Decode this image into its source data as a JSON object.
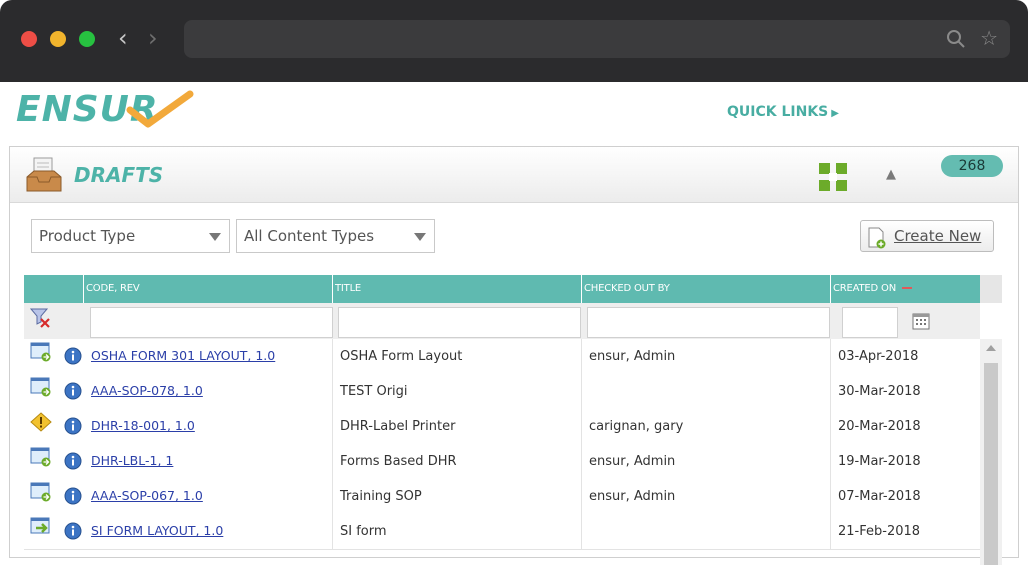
{
  "header": {
    "logo_text": "ENSUR",
    "quick_links_label": "QUICK LINKS",
    "quick_links_arrow": "▶"
  },
  "panel": {
    "title": "DRAFTS",
    "count": "268"
  },
  "filters": {
    "product_type": "Product Type",
    "content_types": "All Content Types",
    "create_new_label": "Create New"
  },
  "grid": {
    "columns": [
      "",
      "CODE, REV",
      "TITLE",
      "CHECKED OUT BY",
      "CREATED ON"
    ],
    "rows": [
      {
        "code": "OSHA FORM 301 LAYOUT, 1.0",
        "title": "OSHA Form Layout",
        "checked_out_by": "ensur, Admin",
        "created_on": "03-Apr-2018",
        "icon": "doc-edit-icon"
      },
      {
        "code": "AAA-SOP-078, 1.0",
        "title": "TEST Origi",
        "checked_out_by": "",
        "created_on": "30-Mar-2018",
        "icon": "doc-edit-icon"
      },
      {
        "code": "DHR-18-001, 1.0",
        "title": "DHR-Label Printer",
        "checked_out_by": "carignan, gary",
        "created_on": "20-Mar-2018",
        "icon": "warning-icon"
      },
      {
        "code": "DHR-LBL-1, 1",
        "title": "Forms Based DHR",
        "checked_out_by": "ensur, Admin",
        "created_on": "19-Mar-2018",
        "icon": "doc-edit-icon"
      },
      {
        "code": "AAA-SOP-067, 1.0",
        "title": "Training SOP",
        "checked_out_by": "ensur, Admin",
        "created_on": "07-Mar-2018",
        "icon": "doc-edit-icon"
      },
      {
        "code": "SI FORM LAYOUT, 1.0",
        "title": "SI form",
        "checked_out_by": "",
        "created_on": "21-Feb-2018",
        "icon": "doc-arrow-icon"
      }
    ]
  },
  "colors": {
    "brand_teal": "#4db3a8",
    "header_row": "#5fbab0",
    "link": "#2b3fa8",
    "check_orange": "#f2a93b"
  }
}
